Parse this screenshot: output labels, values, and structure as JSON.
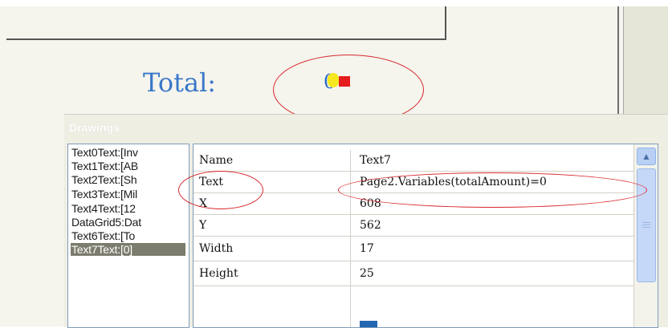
{
  "canvas": {
    "total_label": "Total:",
    "total_value": "0"
  },
  "panel": {
    "title": "Drawings",
    "list_items": [
      "Text0Text:[Inv",
      "Text1Text:[AB",
      "Text2Text:[Sh",
      "Text3Text:[Mil",
      "Text4Text:[12",
      "DataGrid5:Dat",
      "Text6Text:[To",
      "Text7Text:[0]"
    ],
    "selected_index": 7,
    "properties": [
      {
        "name": "Name",
        "value": "Text7"
      },
      {
        "name": "Text",
        "value": "Page2.Variables(totalAmount)=0"
      },
      {
        "name": "X",
        "value": "608"
      },
      {
        "name": "Y",
        "value": "562"
      },
      {
        "name": "Width",
        "value": "17"
      },
      {
        "name": "Height",
        "value": "25"
      }
    ]
  },
  "icons": {
    "scroll_up": "chevron-up-icon"
  },
  "colors": {
    "annotation_red": "#d9282c",
    "total_blue": "#3a78c9",
    "selected_row": "#7c7c6e"
  }
}
